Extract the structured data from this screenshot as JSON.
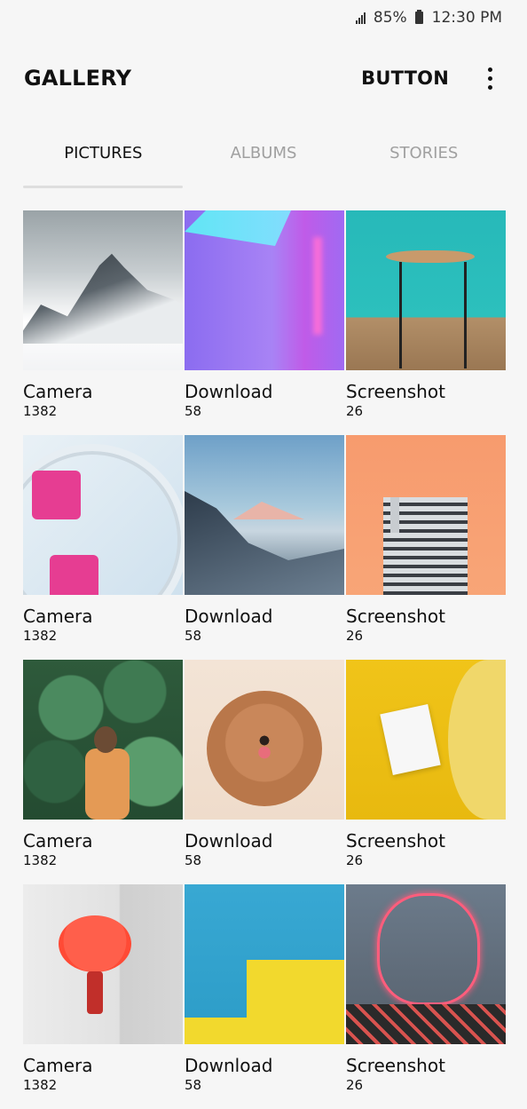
{
  "status_bar": {
    "battery_percent": "85%",
    "time": "12:30 PM"
  },
  "header": {
    "title": "GALLERY",
    "button_label": "BUTTON",
    "more_icon": "more-vert-icon"
  },
  "tabs": [
    {
      "label": "PICTURES",
      "active": true
    },
    {
      "label": "ALBUMS",
      "active": false
    },
    {
      "label": "STORIES",
      "active": false
    }
  ],
  "albums": [
    {
      "name": "Camera",
      "count": "1382",
      "thumbnail": "snowy-mountain"
    },
    {
      "name": "Download",
      "count": "58",
      "thumbnail": "neon-room"
    },
    {
      "name": "Screenshot",
      "count": "26",
      "thumbnail": "stool-teal-wall"
    },
    {
      "name": "Camera",
      "count": "1382",
      "thumbnail": "ferris-wheel"
    },
    {
      "name": "Download",
      "count": "58",
      "thumbnail": "mountain-valley"
    },
    {
      "name": "Screenshot",
      "count": "26",
      "thumbnail": "building-orange-sky"
    },
    {
      "name": "Camera",
      "count": "1382",
      "thumbnail": "girl-cactus"
    },
    {
      "name": "Download",
      "count": "58",
      "thumbnail": "poodle"
    },
    {
      "name": "Screenshot",
      "count": "26",
      "thumbnail": "polaroid-hand"
    },
    {
      "name": "Camera",
      "count": "1382",
      "thumbnail": "red-lamp"
    },
    {
      "name": "Download",
      "count": "58",
      "thumbnail": "yellow-building"
    },
    {
      "name": "Screenshot",
      "count": "26",
      "thumbnail": "neon-portrait"
    }
  ],
  "colors": {
    "background": "#f6f6f6",
    "text": "#111111",
    "inactive_tab": "#a0a0a0"
  }
}
